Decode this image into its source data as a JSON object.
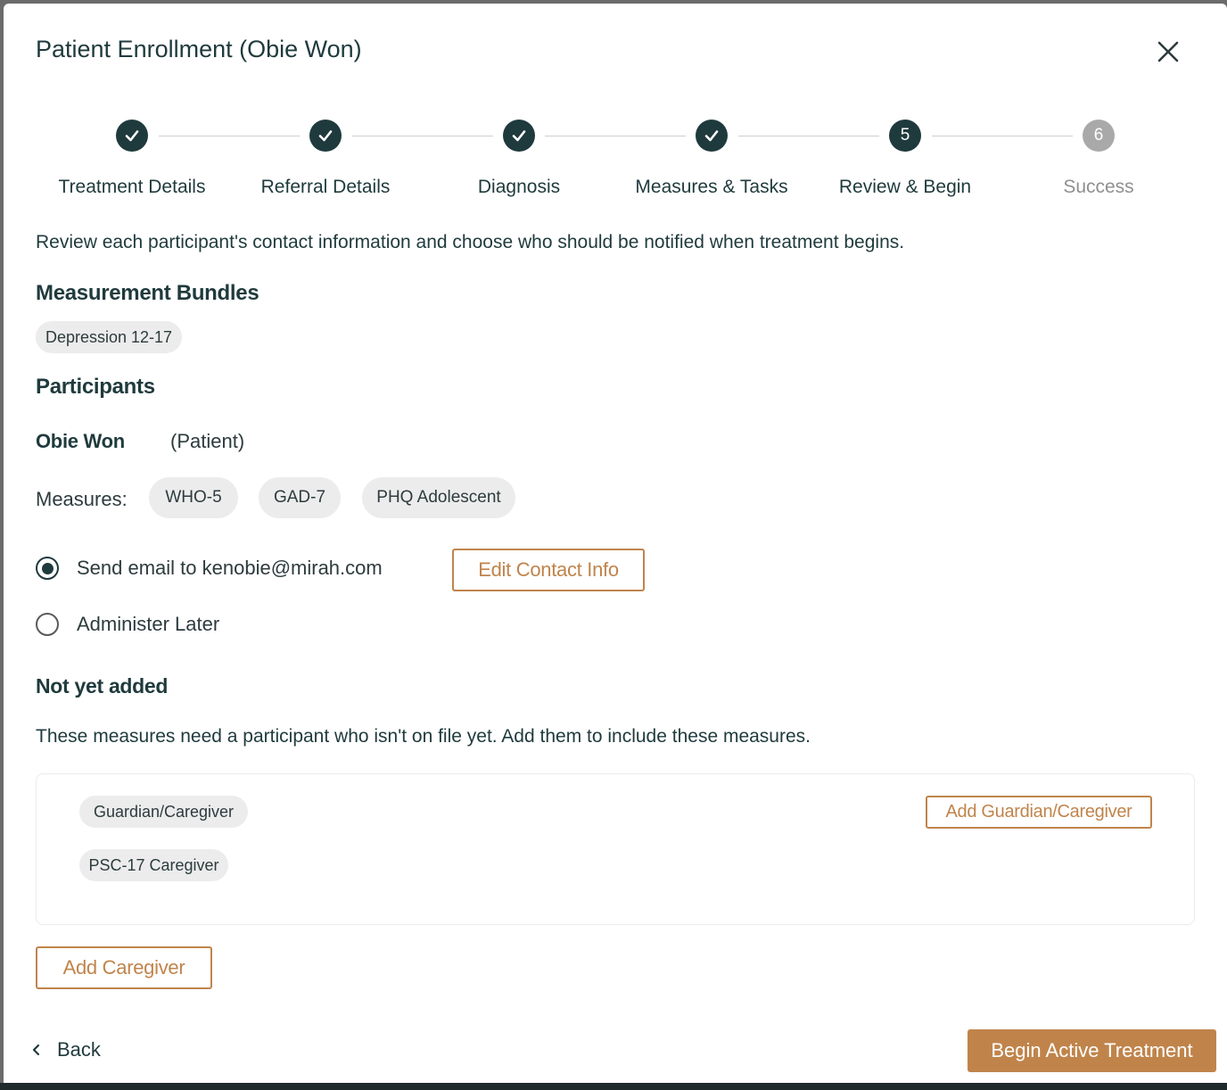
{
  "dialog": {
    "title": "Patient Enrollment (Obie Won)",
    "close_icon": "close-icon"
  },
  "stepper": {
    "steps": [
      {
        "label": "Treatment Details",
        "status": "complete",
        "marker": "✓"
      },
      {
        "label": "Referral Details",
        "status": "complete",
        "marker": "✓"
      },
      {
        "label": "Diagnosis",
        "status": "complete",
        "marker": "✓"
      },
      {
        "label": "Measures & Tasks",
        "status": "complete",
        "marker": "✓"
      },
      {
        "label": "Review & Begin",
        "status": "active",
        "marker": "5"
      },
      {
        "label": "Success",
        "status": "pending",
        "marker": "6"
      }
    ]
  },
  "intro_text": "Review each participant's contact information and choose who should be notified when treatment begins.",
  "bundles": {
    "heading": "Measurement Bundles",
    "items": [
      "Depression 12-17"
    ]
  },
  "participants": {
    "heading": "Participants",
    "patient": {
      "name": "Obie Won",
      "role": "(Patient)",
      "measures_label": "Measures:",
      "measures": [
        "WHO-5",
        "GAD-7",
        "PHQ Adolescent"
      ]
    },
    "options": {
      "send_email": "Send email to kenobie@mirah.com",
      "administer_later": "Administer Later",
      "selected": "send_email"
    },
    "edit_contact_label": "Edit Contact Info"
  },
  "not_yet_added": {
    "heading": "Not yet added",
    "description": "These measures need a participant who isn't on file yet. Add them to include these measures.",
    "participant_type": "Guardian/Caregiver",
    "measure": "PSC-17 Caregiver",
    "add_button": "Add Guardian/Caregiver"
  },
  "add_caregiver_label": "Add Caregiver",
  "footer": {
    "back_label": "Back",
    "back_icon": "chevron-left-icon",
    "primary_label": "Begin Active Treatment"
  },
  "colors": {
    "primary_dark": "#1f3a3d",
    "accent": "#c0844b",
    "chip_bg": "#ececec",
    "pending_step": "#a9a9a9"
  }
}
